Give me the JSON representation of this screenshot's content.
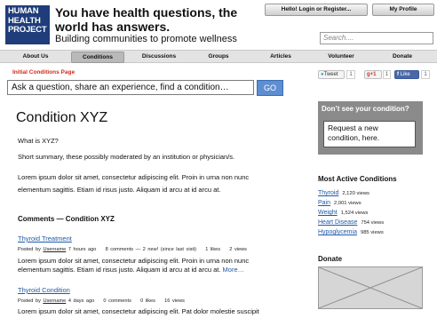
{
  "header": {
    "logo_lines": [
      "HUMAN",
      "HEALTH",
      "PROJECT"
    ],
    "headline": "You have health questions, the world has answers.",
    "subline": "Building communities to promote wellness",
    "login_label": "Hello!  Login or Register...",
    "profile_label": "My Profile",
    "search_placeholder": "Search...."
  },
  "nav": {
    "items": [
      {
        "label": "About Us"
      },
      {
        "label": "Conditions"
      },
      {
        "label": "Discussions"
      },
      {
        "label": "Groups"
      },
      {
        "label": "Articles"
      },
      {
        "label": "Volunteer"
      },
      {
        "label": "Donate"
      }
    ],
    "active": "Conditions"
  },
  "page_label": "Initial Conditions Page",
  "social": {
    "tweet_label": "Tweet",
    "tweet_count": "1",
    "gplus_label": "g+1",
    "gplus_count": "1",
    "like_label": "Like",
    "like_count": "1"
  },
  "ask": {
    "placeholder": "Ask a question, share an experience, find a condition…",
    "go_label": "GO"
  },
  "main": {
    "title": "Condition XYZ",
    "question": "What is XYZ?",
    "summary": "Short summary, these possibly moderated by an institution or physician/s.",
    "lorem1": "Lorem ipsum dolor sit amet, consectetur adipiscing elit. Proin in urna non nunc",
    "lorem2": "elementum sagittis. Etiam id risus justo. Aliquam id arcu at id arcu at.",
    "comments_heading": "Comments — Condition XYZ",
    "comments": [
      {
        "title": "Thyroid Treatment",
        "posted_by": "Posted by",
        "user": "Username",
        "meta": "7 hours ago    8 comments — 2 new! (since last visit)    1 likes    2 views",
        "body1": "Lorem ipsum dolor sit amet, consectetur adipiscing elit. Proin in urna non nunc",
        "body2": "elementum sagittis. Etiam id risus justo. Aliquam id arcu at id arcu at.",
        "more": "More…"
      },
      {
        "title": "Thyroid Condition",
        "posted_by": "Posted by",
        "user": "Username",
        "meta": "4 days ago    0 comments    0 likes    16 views",
        "body1": "Lorem ipsum dolor sit amet, consectetur adipiscing elit. Pat dolor molestie suscipit",
        "body2": "",
        "more": ""
      }
    ]
  },
  "sidebar": {
    "dontsee_heading": "Don’t see your condition?",
    "dontsee_box": "Request a new condition, here.",
    "active_heading": "Most Active Conditions",
    "conditions": [
      {
        "name": "Thyroid",
        "views": "2,120 views"
      },
      {
        "name": "Pain",
        "views": "2,001 views"
      },
      {
        "name": "Weight",
        "views": "1,524 views"
      },
      {
        "name": "Heart Disease",
        "views": "754 views"
      },
      {
        "name": "Hypoglycemia",
        "views": "985 views"
      }
    ],
    "donate_heading": "Donate"
  },
  "colors": {
    "brand": "#1f3d7a",
    "link": "#1f5aa8",
    "label_red": "#d22a1c",
    "go_button": "#5d8ed1"
  }
}
